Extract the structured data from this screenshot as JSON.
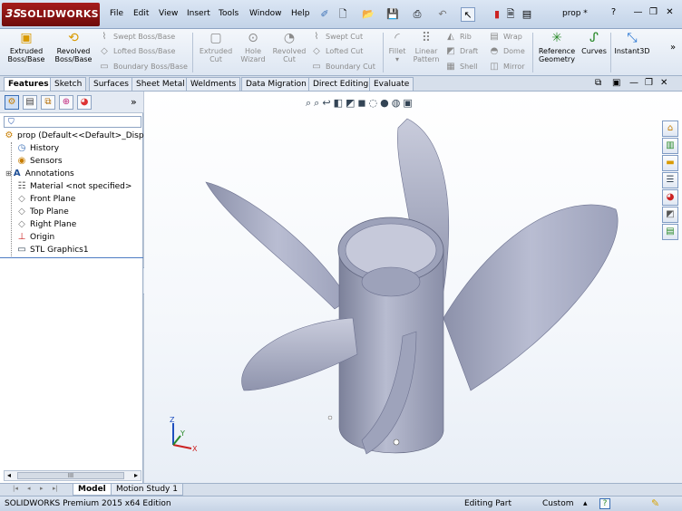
{
  "app": {
    "logo_ds": "3S",
    "logo_text": "SOLIDWORKS"
  },
  "menu": [
    "File",
    "Edit",
    "View",
    "Insert",
    "Tools",
    "Window",
    "Help"
  ],
  "document_title": "prop *",
  "window_controls": {
    "help": "?",
    "minimize": "—",
    "restore": "❐",
    "close": "✕"
  },
  "command_manager": {
    "extruded_boss": [
      "Extruded",
      "Boss/Base"
    ],
    "revolved_boss": [
      "Revolved",
      "Boss/Base"
    ],
    "swept_boss": "Swept Boss/Base",
    "lofted_boss": "Lofted Boss/Base",
    "boundary_boss": "Boundary Boss/Base",
    "extruded_cut": [
      "Extruded",
      "Cut"
    ],
    "hole_wizard": [
      "Hole",
      "Wizard"
    ],
    "revolved_cut": [
      "Revolved",
      "Cut"
    ],
    "swept_cut": "Swept Cut",
    "lofted_cut": "Lofted Cut",
    "boundary_cut": "Boundary Cut",
    "fillet": "Fillet",
    "linear_pattern": [
      "Linear",
      "Pattern"
    ],
    "rib": "Rib",
    "wrap": "Wrap",
    "draft": "Draft",
    "dome": "Dome",
    "shell": "Shell",
    "mirror": "Mirror",
    "reference_geometry": [
      "Reference",
      "Geometry"
    ],
    "curves": "Curves",
    "instant3d": "Instant3D",
    "more": "»"
  },
  "tabs": [
    "Features",
    "Sketch",
    "Surfaces",
    "Sheet Metal",
    "Weldments",
    "Data Migration",
    "Direct Editing",
    "Evaluate"
  ],
  "active_tab": "Features",
  "feature_manager": {
    "filter_icon": "filter-icon",
    "more": "»",
    "tree": [
      {
        "label": "prop  (Default<<Default>_Displa",
        "icon": "part-icon"
      },
      {
        "label": "History",
        "icon": "history-icon"
      },
      {
        "label": "Sensors",
        "icon": "sensors-icon"
      },
      {
        "label": "Annotations",
        "icon": "annotations-icon"
      },
      {
        "label": "Material <not specified>",
        "icon": "material-icon"
      },
      {
        "label": "Front Plane",
        "icon": "plane-icon"
      },
      {
        "label": "Top Plane",
        "icon": "plane-icon"
      },
      {
        "label": "Right Plane",
        "icon": "plane-icon"
      },
      {
        "label": "Origin",
        "icon": "origin-icon"
      },
      {
        "label": "STL Graphics1",
        "icon": "stl-graphics-icon"
      }
    ],
    "scroll_label": "III"
  },
  "view_controls": [
    "⧉",
    "▣",
    "—",
    "❐",
    "✕"
  ],
  "triad": {
    "x": "X",
    "y": "Y",
    "z": "Z"
  },
  "bottom_tabs": [
    "Model",
    "Motion Study 1"
  ],
  "active_bottom_tab": "Model",
  "status": {
    "edition": "SOLIDWORKS Premium 2015 x64 Edition",
    "mode": "Editing Part",
    "units": "Custom",
    "units_arrow": "▴",
    "help": "?"
  },
  "colors": {
    "model": "#a8adc4",
    "viewport_top": "#ffffff",
    "viewport_bottom": "#e8eef6",
    "logo": "#8f1616"
  }
}
